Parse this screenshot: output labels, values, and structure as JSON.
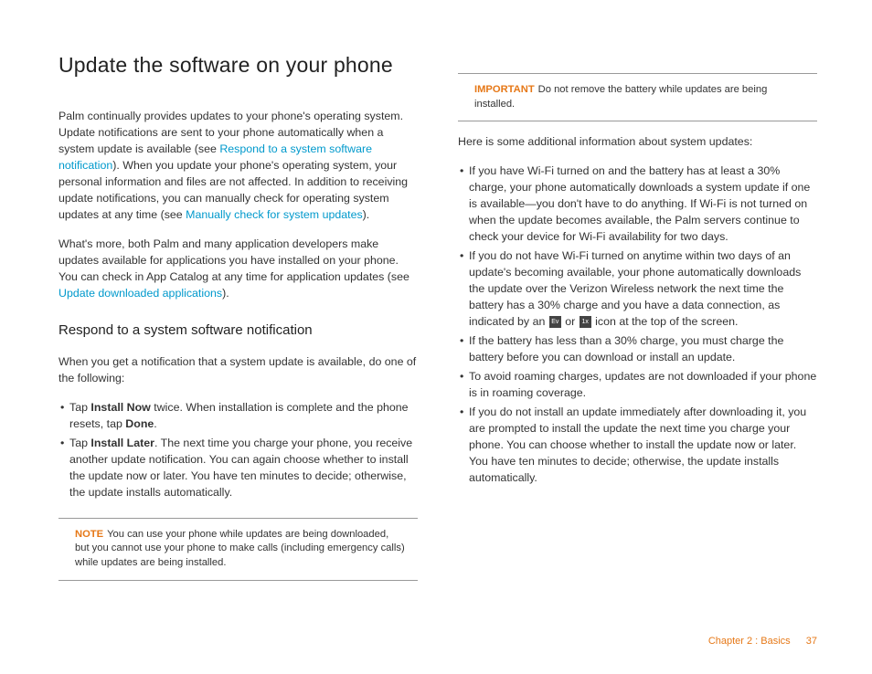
{
  "heading": "Update the software on your phone",
  "p1a": "Palm continually provides updates to your phone's operating system. Update notifications are sent to your phone automatically when a system update is available (see ",
  "p1link1": "Respond to a system software notification",
  "p1b": "). When you update your phone's operating system, your personal information and files are not affected. In addition to receiving update notifications, you can manually check for operating system updates at any time (see ",
  "p1link2": "Manually check for system updates",
  "p1c": ").",
  "p2a": "What's more, both Palm and many application developers make updates available for applications you have installed on your phone. You can check in App Catalog at any time for application updates (see ",
  "p2link": "Update downloaded applications",
  "p2b": ").",
  "h2": "Respond to a system software notification",
  "p3": "When you get a notification that a system update is available, do one of the following:",
  "li1a": "Tap ",
  "li1b": "Install Now",
  "li1c": " twice. When installation is complete and the phone resets, tap ",
  "li1d": "Done",
  "li1e": ".",
  "li2a": "Tap ",
  "li2b": "Install Later",
  "li2c": ". The next time you charge your phone, you receive another update notification. You can again choose whether to install the update now or later. You have ten minutes to decide; otherwise, the update installs automatically.",
  "noteLabel": "NOTE",
  "noteBody": "You can use your phone while updates are being downloaded, but you cannot use your phone to make calls (including emergency calls) while updates are being installed.",
  "importantLabel": "IMPORTANT",
  "importantBody": "Do not remove the battery while updates are being installed.",
  "p4": "Here is some additional information about system updates:",
  "rli1": "If you have Wi-Fi turned on and the battery has at least a 30% charge, your phone automatically downloads a system update if one is available—you don't have to do anything. If Wi-Fi is not turned on when the update becomes available, the Palm servers continue to check your device for Wi-Fi availability for two days.",
  "rli2a": "If you do not have Wi-Fi turned on anytime within two days of an update's becoming available, your phone automatically downloads the update over the Verizon Wireless network the next time the battery has a 30% charge and you have a data connection, as indicated by an ",
  "rli2b": " or ",
  "rli2c": " icon at the top of the screen.",
  "icon1": "Ev",
  "icon2": "1x",
  "rli3": "If the battery has less than a 30% charge, you must charge the battery before you can download or install an update.",
  "rli4": "To avoid roaming charges, updates are not downloaded if your phone is in roaming coverage.",
  "rli5": "If you do not install an update immediately after downloading it, you are prompted to install the update the next time you charge your phone. You can choose whether to install the update now or later. You have ten minutes to decide; otherwise, the update installs automatically.",
  "footerChapter": "Chapter 2 : Basics",
  "footerPage": "37"
}
